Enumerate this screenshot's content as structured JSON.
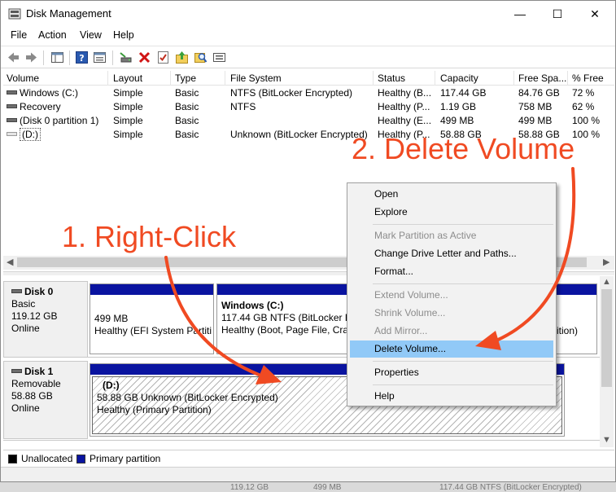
{
  "window": {
    "title": "Disk Management",
    "controls": {
      "minimize": "—",
      "maximize": "☐",
      "close": "✕"
    }
  },
  "menu": [
    "File",
    "Action",
    "View",
    "Help"
  ],
  "toolbar_icons": [
    "back-arrow-icon",
    "forward-arrow-icon",
    "console-tree-icon",
    "help-icon",
    "properties-sheet-icon",
    "connect-disk-icon",
    "delete-icon",
    "checklist-icon",
    "up-folder-icon",
    "search-icon",
    "rescan-disks-icon"
  ],
  "volume_list": {
    "columns": [
      "Volume",
      "Layout",
      "Type",
      "File System",
      "Status",
      "Capacity",
      "Free Spa...",
      "% Free"
    ],
    "rows": [
      {
        "volume": "Windows (C:)",
        "layout": "Simple",
        "type": "Basic",
        "fs": "NTFS (BitLocker Encrypted)",
        "status": "Healthy (B...",
        "capacity": "117.44 GB",
        "free": "84.76 GB",
        "pct": "72 %"
      },
      {
        "volume": "Recovery",
        "layout": "Simple",
        "type": "Basic",
        "fs": "NTFS",
        "status": "Healthy (P...",
        "capacity": "1.19 GB",
        "free": "758 MB",
        "pct": "62 %"
      },
      {
        "volume": "(Disk 0 partition 1)",
        "layout": "Simple",
        "type": "Basic",
        "fs": "",
        "status": "Healthy (E...",
        "capacity": "499 MB",
        "free": "499 MB",
        "pct": "100 %"
      },
      {
        "volume": "(D:)",
        "layout": "Simple",
        "type": "Basic",
        "fs": "Unknown (BitLocker Encrypted)",
        "status": "Healthy (P...",
        "capacity": "58.88 GB",
        "free": "58.88 GB",
        "pct": "100 %"
      }
    ]
  },
  "disks": [
    {
      "name": "Disk 0",
      "type": "Basic",
      "size": "119.12 GB",
      "state": "Online",
      "partitions": [
        {
          "title": "",
          "line1": "499 MB",
          "line2": "Healthy (EFI System Partiti"
        },
        {
          "title": "Windows  (C:)",
          "line1": "117.44 GB NTFS (BitLocker En",
          "line2": "Healthy (Boot, Page File, Cras"
        },
        {
          "title": "",
          "line1": "",
          "line2": "ition)"
        }
      ]
    },
    {
      "name": "Disk 1",
      "type": "Removable",
      "size": "58.88 GB",
      "state": "Online",
      "partitions": [
        {
          "title": "(D:)",
          "line1": "58.88 GB Unknown (BitLocker Encrypted)",
          "line2": "Healthy (Primary Partition)"
        }
      ]
    }
  ],
  "legend": [
    {
      "label": "Unallocated",
      "color": "#000000"
    },
    {
      "label": "Primary partition",
      "color": "#0a14a0"
    }
  ],
  "background_strip": [
    "119.12 GB",
    "499 MB",
    "117.44 GB NTFS (BitLocker Encrypted)"
  ],
  "context_menu": {
    "items": [
      {
        "label": "Open",
        "enabled": true
      },
      {
        "label": "Explore",
        "enabled": true
      },
      {
        "label": "Mark Partition as Active",
        "enabled": false
      },
      {
        "label": "Change Drive Letter and Paths...",
        "enabled": true
      },
      {
        "label": "Format...",
        "enabled": true
      },
      {
        "label": "Extend Volume...",
        "enabled": false
      },
      {
        "label": "Shrink Volume...",
        "enabled": false
      },
      {
        "label": "Add Mirror...",
        "enabled": false
      },
      {
        "label": "Delete Volume...",
        "enabled": true,
        "highlighted": true
      },
      {
        "label": "Properties",
        "enabled": true
      },
      {
        "label": "Help",
        "enabled": true
      }
    ]
  },
  "annotations": {
    "step1": "1. Right-Click",
    "step2": "2. Delete Volume",
    "color": "#f04a22"
  }
}
